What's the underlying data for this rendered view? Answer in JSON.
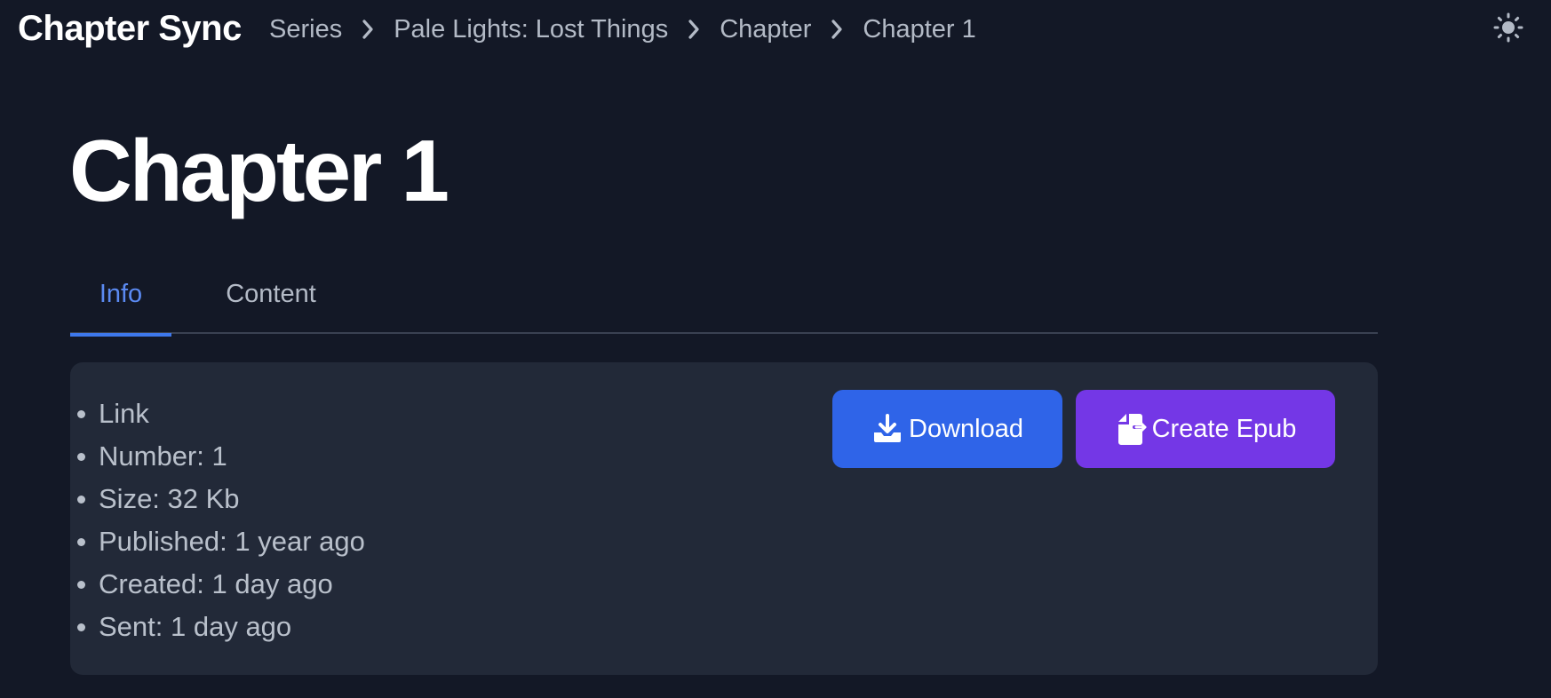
{
  "navbar": {
    "brand": "Chapter Sync",
    "breadcrumb": [
      {
        "label": "Series"
      },
      {
        "label": "Pale Lights: Lost Things"
      },
      {
        "label": "Chapter"
      },
      {
        "label": "Chapter 1"
      }
    ],
    "separator_icon": "chevron-right-icon",
    "theme_icon": "sun-icon"
  },
  "page": {
    "title": "Chapter 1"
  },
  "tabs": [
    {
      "label": "Info",
      "active": true
    },
    {
      "label": "Content",
      "active": false
    }
  ],
  "info": {
    "items": [
      "Link",
      "Number: 1",
      "Size: 32 Kb",
      "Published: 1 year ago",
      "Created: 1 day ago",
      "Sent: 1 day ago"
    ]
  },
  "actions": {
    "download_label": "Download",
    "download_icon": "download-tray-icon",
    "epub_label": "Create Epub",
    "epub_icon": "file-export-icon"
  },
  "colors": {
    "background": "#131826",
    "card": "#222938",
    "accent_blue": "#2f64e8",
    "accent_purple": "#7437e6",
    "active_tab": "#5b8af2"
  }
}
